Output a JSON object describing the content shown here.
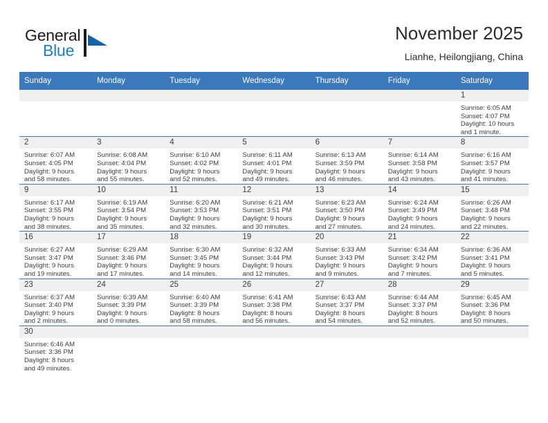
{
  "brand": {
    "name_part1": "General",
    "name_part2": "Blue",
    "mark": "triangle-logo-icon",
    "color_dark": "#1b1b1b",
    "color_blue": "#1b7fc4"
  },
  "header": {
    "title": "November 2025",
    "subtitle": "Lianhe, Heilongjiang, China"
  },
  "theme": {
    "header_bar": "#3b78bc",
    "daynum_bg": "#f0f0f0",
    "row_divider": "#3b78bc",
    "text": "#3d3d3d"
  },
  "weekdays": [
    "Sunday",
    "Monday",
    "Tuesday",
    "Wednesday",
    "Thursday",
    "Friday",
    "Saturday"
  ],
  "weeks": [
    [
      {
        "day": "",
        "empty": true,
        "sunrise": "",
        "sunset": "",
        "daylight1": "",
        "daylight2": ""
      },
      {
        "day": "",
        "empty": true,
        "sunrise": "",
        "sunset": "",
        "daylight1": "",
        "daylight2": ""
      },
      {
        "day": "",
        "empty": true,
        "sunrise": "",
        "sunset": "",
        "daylight1": "",
        "daylight2": ""
      },
      {
        "day": "",
        "empty": true,
        "sunrise": "",
        "sunset": "",
        "daylight1": "",
        "daylight2": ""
      },
      {
        "day": "",
        "empty": true,
        "sunrise": "",
        "sunset": "",
        "daylight1": "",
        "daylight2": ""
      },
      {
        "day": "",
        "empty": true,
        "sunrise": "",
        "sunset": "",
        "daylight1": "",
        "daylight2": ""
      },
      {
        "day": "1",
        "empty": false,
        "sunrise": "Sunrise: 6:05 AM",
        "sunset": "Sunset: 4:07 PM",
        "daylight1": "Daylight: 10 hours",
        "daylight2": "and 1 minute."
      }
    ],
    [
      {
        "day": "2",
        "empty": false,
        "sunrise": "Sunrise: 6:07 AM",
        "sunset": "Sunset: 4:05 PM",
        "daylight1": "Daylight: 9 hours",
        "daylight2": "and 58 minutes."
      },
      {
        "day": "3",
        "empty": false,
        "sunrise": "Sunrise: 6:08 AM",
        "sunset": "Sunset: 4:04 PM",
        "daylight1": "Daylight: 9 hours",
        "daylight2": "and 55 minutes."
      },
      {
        "day": "4",
        "empty": false,
        "sunrise": "Sunrise: 6:10 AM",
        "sunset": "Sunset: 4:02 PM",
        "daylight1": "Daylight: 9 hours",
        "daylight2": "and 52 minutes."
      },
      {
        "day": "5",
        "empty": false,
        "sunrise": "Sunrise: 6:11 AM",
        "sunset": "Sunset: 4:01 PM",
        "daylight1": "Daylight: 9 hours",
        "daylight2": "and 49 minutes."
      },
      {
        "day": "6",
        "empty": false,
        "sunrise": "Sunrise: 6:13 AM",
        "sunset": "Sunset: 3:59 PM",
        "daylight1": "Daylight: 9 hours",
        "daylight2": "and 46 minutes."
      },
      {
        "day": "7",
        "empty": false,
        "sunrise": "Sunrise: 6:14 AM",
        "sunset": "Sunset: 3:58 PM",
        "daylight1": "Daylight: 9 hours",
        "daylight2": "and 43 minutes."
      },
      {
        "day": "8",
        "empty": false,
        "sunrise": "Sunrise: 6:16 AM",
        "sunset": "Sunset: 3:57 PM",
        "daylight1": "Daylight: 9 hours",
        "daylight2": "and 41 minutes."
      }
    ],
    [
      {
        "day": "9",
        "empty": false,
        "sunrise": "Sunrise: 6:17 AM",
        "sunset": "Sunset: 3:55 PM",
        "daylight1": "Daylight: 9 hours",
        "daylight2": "and 38 minutes."
      },
      {
        "day": "10",
        "empty": false,
        "sunrise": "Sunrise: 6:19 AM",
        "sunset": "Sunset: 3:54 PM",
        "daylight1": "Daylight: 9 hours",
        "daylight2": "and 35 minutes."
      },
      {
        "day": "11",
        "empty": false,
        "sunrise": "Sunrise: 6:20 AM",
        "sunset": "Sunset: 3:53 PM",
        "daylight1": "Daylight: 9 hours",
        "daylight2": "and 32 minutes."
      },
      {
        "day": "12",
        "empty": false,
        "sunrise": "Sunrise: 6:21 AM",
        "sunset": "Sunset: 3:51 PM",
        "daylight1": "Daylight: 9 hours",
        "daylight2": "and 30 minutes."
      },
      {
        "day": "13",
        "empty": false,
        "sunrise": "Sunrise: 6:23 AM",
        "sunset": "Sunset: 3:50 PM",
        "daylight1": "Daylight: 9 hours",
        "daylight2": "and 27 minutes."
      },
      {
        "day": "14",
        "empty": false,
        "sunrise": "Sunrise: 6:24 AM",
        "sunset": "Sunset: 3:49 PM",
        "daylight1": "Daylight: 9 hours",
        "daylight2": "and 24 minutes."
      },
      {
        "day": "15",
        "empty": false,
        "sunrise": "Sunrise: 6:26 AM",
        "sunset": "Sunset: 3:48 PM",
        "daylight1": "Daylight: 9 hours",
        "daylight2": "and 22 minutes."
      }
    ],
    [
      {
        "day": "16",
        "empty": false,
        "sunrise": "Sunrise: 6:27 AM",
        "sunset": "Sunset: 3:47 PM",
        "daylight1": "Daylight: 9 hours",
        "daylight2": "and 19 minutes."
      },
      {
        "day": "17",
        "empty": false,
        "sunrise": "Sunrise: 6:29 AM",
        "sunset": "Sunset: 3:46 PM",
        "daylight1": "Daylight: 9 hours",
        "daylight2": "and 17 minutes."
      },
      {
        "day": "18",
        "empty": false,
        "sunrise": "Sunrise: 6:30 AM",
        "sunset": "Sunset: 3:45 PM",
        "daylight1": "Daylight: 9 hours",
        "daylight2": "and 14 minutes."
      },
      {
        "day": "19",
        "empty": false,
        "sunrise": "Sunrise: 6:32 AM",
        "sunset": "Sunset: 3:44 PM",
        "daylight1": "Daylight: 9 hours",
        "daylight2": "and 12 minutes."
      },
      {
        "day": "20",
        "empty": false,
        "sunrise": "Sunrise: 6:33 AM",
        "sunset": "Sunset: 3:43 PM",
        "daylight1": "Daylight: 9 hours",
        "daylight2": "and 9 minutes."
      },
      {
        "day": "21",
        "empty": false,
        "sunrise": "Sunrise: 6:34 AM",
        "sunset": "Sunset: 3:42 PM",
        "daylight1": "Daylight: 9 hours",
        "daylight2": "and 7 minutes."
      },
      {
        "day": "22",
        "empty": false,
        "sunrise": "Sunrise: 6:36 AM",
        "sunset": "Sunset: 3:41 PM",
        "daylight1": "Daylight: 9 hours",
        "daylight2": "and 5 minutes."
      }
    ],
    [
      {
        "day": "23",
        "empty": false,
        "sunrise": "Sunrise: 6:37 AM",
        "sunset": "Sunset: 3:40 PM",
        "daylight1": "Daylight: 9 hours",
        "daylight2": "and 2 minutes."
      },
      {
        "day": "24",
        "empty": false,
        "sunrise": "Sunrise: 6:39 AM",
        "sunset": "Sunset: 3:39 PM",
        "daylight1": "Daylight: 9 hours",
        "daylight2": "and 0 minutes."
      },
      {
        "day": "25",
        "empty": false,
        "sunrise": "Sunrise: 6:40 AM",
        "sunset": "Sunset: 3:39 PM",
        "daylight1": "Daylight: 8 hours",
        "daylight2": "and 58 minutes."
      },
      {
        "day": "26",
        "empty": false,
        "sunrise": "Sunrise: 6:41 AM",
        "sunset": "Sunset: 3:38 PM",
        "daylight1": "Daylight: 8 hours",
        "daylight2": "and 56 minutes."
      },
      {
        "day": "27",
        "empty": false,
        "sunrise": "Sunrise: 6:43 AM",
        "sunset": "Sunset: 3:37 PM",
        "daylight1": "Daylight: 8 hours",
        "daylight2": "and 54 minutes."
      },
      {
        "day": "28",
        "empty": false,
        "sunrise": "Sunrise: 6:44 AM",
        "sunset": "Sunset: 3:37 PM",
        "daylight1": "Daylight: 8 hours",
        "daylight2": "and 52 minutes."
      },
      {
        "day": "29",
        "empty": false,
        "sunrise": "Sunrise: 6:45 AM",
        "sunset": "Sunset: 3:36 PM",
        "daylight1": "Daylight: 8 hours",
        "daylight2": "and 50 minutes."
      }
    ],
    [
      {
        "day": "30",
        "empty": false,
        "sunrise": "Sunrise: 6:46 AM",
        "sunset": "Sunset: 3:36 PM",
        "daylight1": "Daylight: 8 hours",
        "daylight2": "and 49 minutes."
      },
      {
        "day": "",
        "empty": true,
        "sunrise": "",
        "sunset": "",
        "daylight1": "",
        "daylight2": ""
      },
      {
        "day": "",
        "empty": true,
        "sunrise": "",
        "sunset": "",
        "daylight1": "",
        "daylight2": ""
      },
      {
        "day": "",
        "empty": true,
        "sunrise": "",
        "sunset": "",
        "daylight1": "",
        "daylight2": ""
      },
      {
        "day": "",
        "empty": true,
        "sunrise": "",
        "sunset": "",
        "daylight1": "",
        "daylight2": ""
      },
      {
        "day": "",
        "empty": true,
        "sunrise": "",
        "sunset": "",
        "daylight1": "",
        "daylight2": ""
      },
      {
        "day": "",
        "empty": true,
        "sunrise": "",
        "sunset": "",
        "daylight1": "",
        "daylight2": ""
      }
    ]
  ]
}
